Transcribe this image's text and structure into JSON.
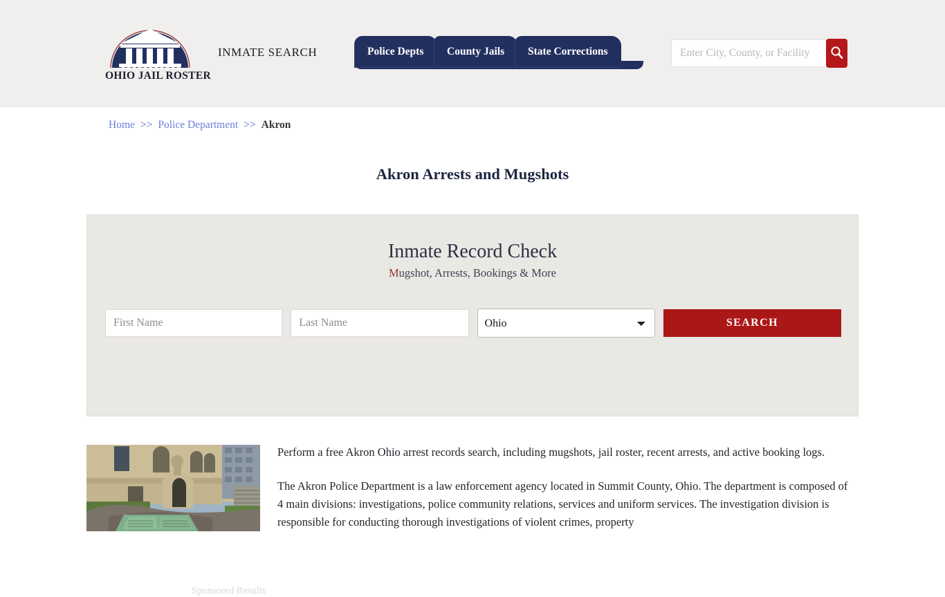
{
  "header": {
    "logo": {
      "name": "logo-ohio-jail-roster",
      "text": "OHIO JAIL ROSTER",
      "building_icon": "courthouse-icon"
    },
    "tagline": "INMATE SEARCH",
    "nav": [
      {
        "label": "Police Depts",
        "name": "nav-tab-police-depts"
      },
      {
        "label": "County Jails",
        "name": "nav-tab-county-jails"
      },
      {
        "label": "State Corrections",
        "name": "nav-tab-state-corrections"
      }
    ],
    "search": {
      "placeholder": "Enter City, County, or Facility",
      "value": "",
      "button_icon": "search-icon"
    },
    "background": "#f0efee",
    "nav_color": "#22305f",
    "accent_red": "#b5181b"
  },
  "breadcrumb": {
    "home": "Home",
    "sep1": ">>",
    "section": "Police Department",
    "sep2": ">>",
    "current": "Akron"
  },
  "page": {
    "title": "Akron Arrests and Mugshots"
  },
  "search_card": {
    "title": "Inmate Record Check",
    "subtitle_accent": "M",
    "subtitle_rest": "ugshot, Arrests, Bookings & More",
    "first_name_placeholder": "First Name",
    "first_name_value": "",
    "last_name_placeholder": "Last Name",
    "last_name_value": "",
    "state_selected": "Ohio",
    "state_options": [
      "Ohio"
    ],
    "search_button": "SEARCH",
    "sponsored_label": "Sponsored Results",
    "background": "#eae8e4",
    "button_color": "#ab1717"
  },
  "article": {
    "photo_alt": "akron-courthouse-photo",
    "paragraphs": [
      "Perform a free Akron Ohio arrest records search, including mugshots, jail roster, recent arrests, and active booking logs.",
      "The Akron Police Department is a law enforcement agency located in Summit County, Ohio. The department is composed of 4 main divisions: investigations, police community relations, services and uniform services. The investigation division is responsible for conducting thorough investigations of violent crimes, property"
    ]
  }
}
